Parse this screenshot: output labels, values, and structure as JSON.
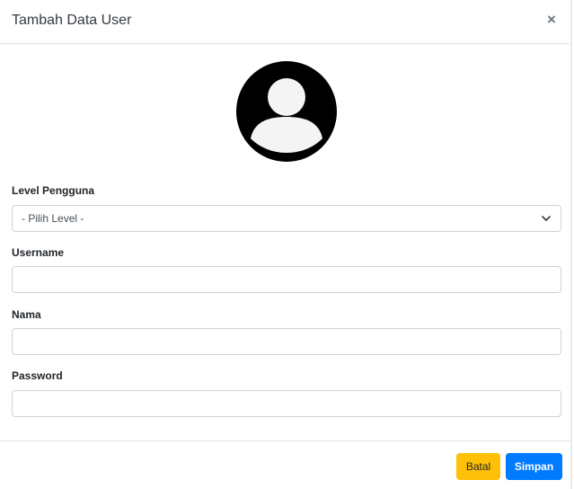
{
  "modal": {
    "title": "Tambah Data User",
    "close_label": "×"
  },
  "form": {
    "level": {
      "label": "Level Pengguna",
      "selected": "- Pilih Level -"
    },
    "username": {
      "label": "Username",
      "value": ""
    },
    "nama": {
      "label": "Nama",
      "value": ""
    },
    "password": {
      "label": "Password",
      "value": ""
    }
  },
  "footer": {
    "cancel_label": "Batal",
    "save_label": "Simpan"
  },
  "colors": {
    "cancel_button": "#ffc107",
    "save_button": "#007bff",
    "avatar": "#000000"
  },
  "icons": {
    "avatar": "user-avatar-icon",
    "close": "close-icon",
    "select": "chevron-down-icon"
  }
}
